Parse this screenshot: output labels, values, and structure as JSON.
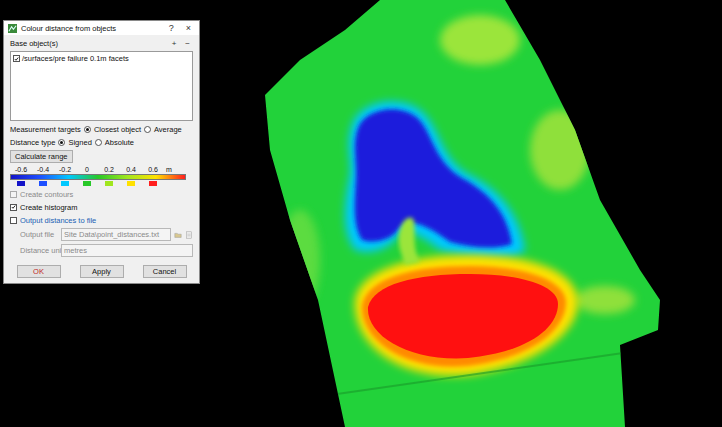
{
  "window": {
    "title": "Colour distance from objects",
    "help": "?",
    "close": "×"
  },
  "base_objects": {
    "label": "Base object(s)",
    "add": "+",
    "remove": "−",
    "items": [
      {
        "label": "/surfaces/pre failure 0.1m facets",
        "checked": true
      }
    ]
  },
  "measurement_targets": {
    "label": "Measurement targets",
    "options": [
      {
        "label": "Closest object",
        "selected": true
      },
      {
        "label": "Average",
        "selected": false
      }
    ]
  },
  "distance_type": {
    "label": "Distance type",
    "options": [
      {
        "label": "Signed",
        "selected": true
      },
      {
        "label": "Absolute",
        "selected": false
      }
    ]
  },
  "calculate_button": "Calculate range",
  "colour_scale": {
    "unit": "m",
    "stops": [
      {
        "label": "-0.6",
        "color": "#1414c8"
      },
      {
        "label": "-0.4",
        "color": "#1e50ff"
      },
      {
        "label": "-0.2",
        "color": "#00c8ff"
      },
      {
        "label": "0",
        "color": "#28c828"
      },
      {
        "label": "0.2",
        "color": "#a0e61e"
      },
      {
        "label": "0.4",
        "color": "#ffe100"
      },
      {
        "label": "0.6",
        "color": "#ff1e1e"
      }
    ]
  },
  "checkboxes": [
    {
      "label": "Create contours",
      "checked": false,
      "disabled": true
    },
    {
      "label": "Create histogram",
      "checked": true,
      "disabled": false
    }
  ],
  "output": {
    "label": "Output distances to file",
    "checked": false,
    "disabled": true,
    "file_label": "Output file",
    "file_value": "Site Data\\point_distances.txt",
    "unit_label": "Distance unit",
    "unit_value": "metres"
  },
  "buttons": [
    {
      "label": "OK"
    },
    {
      "label": "Apply"
    },
    {
      "label": "Cancel"
    }
  ]
}
